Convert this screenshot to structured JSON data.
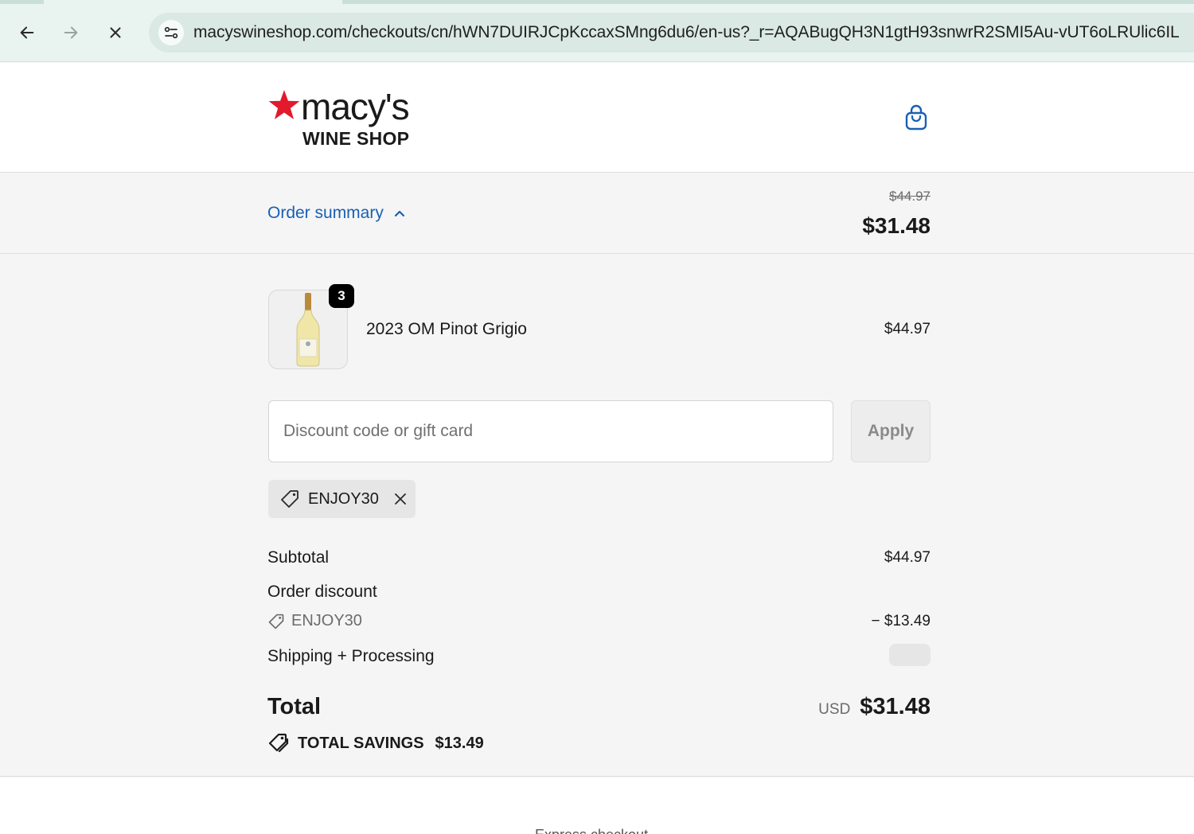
{
  "browser": {
    "url": "macyswineshop.com/checkouts/cn/hWN7DUIRJCpKccaxSMng6du6/en-us?_r=AQABugQH3N1gtH93snwrR2SMI5Au-vUT6oLRUlic6IL"
  },
  "header": {
    "logo_wordmark": "macy's",
    "logo_subtitle": "WINE SHOP",
    "brand_color": "#e21a2c",
    "cart_icon": "shopping-bag-icon"
  },
  "summary": {
    "toggle_label": "Order summary",
    "original_price": "$44.97",
    "current_price": "$31.48"
  },
  "item": {
    "quantity": "3",
    "name": "2023 OM Pinot Grigio",
    "price": "$44.97"
  },
  "discount": {
    "placeholder": "Discount code or gift card",
    "value": "",
    "apply_label": "Apply",
    "applied_code": "ENJOY30"
  },
  "totals": {
    "subtotal_label": "Subtotal",
    "subtotal_value": "$44.97",
    "order_discount_label": "Order discount",
    "discount_code": "ENJOY30",
    "discount_value": "− $13.49",
    "shipping_label": "Shipping + Processing",
    "total_label": "Total",
    "currency": "USD",
    "total_value": "$31.48",
    "savings_label": "TOTAL SAVINGS",
    "savings_value": "$13.49"
  },
  "footer": {
    "partial_text": "Express checkout"
  },
  "colors": {
    "link_blue": "#1a5fb4",
    "chrome_bg": "#e9f4f1",
    "page_bg": "#f5f5f5"
  }
}
